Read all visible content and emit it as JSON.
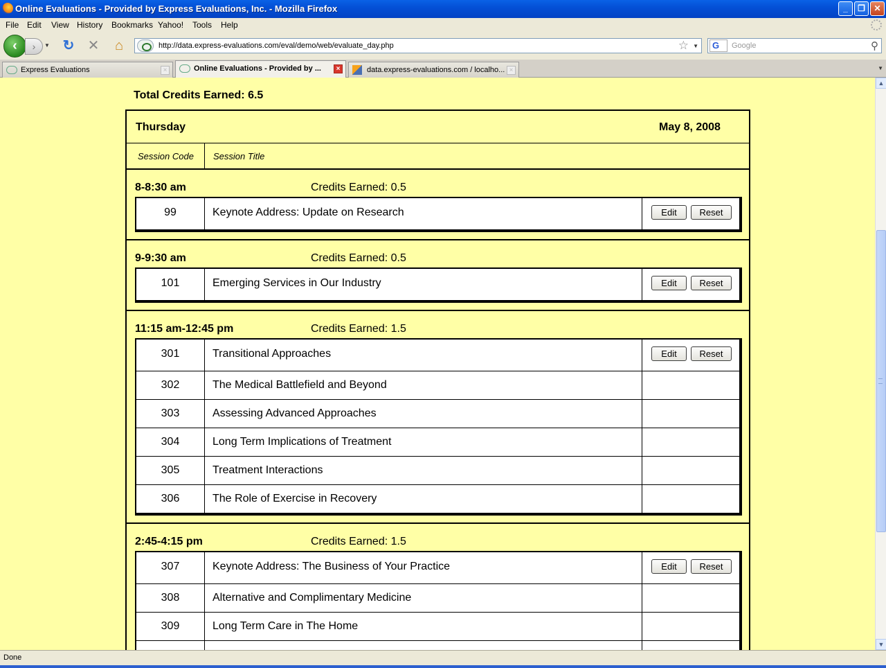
{
  "window": {
    "title": "Online Evaluations - Provided by Express Evaluations, Inc. - Mozilla Firefox",
    "minimize": "_",
    "restore": "❐",
    "close": "✕"
  },
  "menu": [
    "File",
    "Edit",
    "View",
    "History",
    "Bookmarks",
    "Yahoo!",
    "Tools",
    "Help"
  ],
  "nav": {
    "url": "http://data.express-evaluations.com/eval/demo/web/evaluate_day.php",
    "search_placeholder": "Google",
    "search_engine": "G"
  },
  "tabs": [
    {
      "label": "Express Evaluations",
      "active": false
    },
    {
      "label": "Online Evaluations - Provided by ...",
      "active": true
    },
    {
      "label": "data.express-evaluations.com / localho...",
      "active": false
    }
  ],
  "page": {
    "total_credits": "Total Credits Earned: 6.5",
    "day": "Thursday",
    "date": "May 8, 2008",
    "col_code": "Session Code",
    "col_title": "Session Title",
    "edit_label": "Edit",
    "reset_label": "Reset",
    "slots": [
      {
        "time": "8-8:30 am",
        "credits": "Credits Earned: 0.5",
        "sessions": [
          {
            "code": "99",
            "title": "Keynote Address: Update on Research",
            "actions": true
          }
        ]
      },
      {
        "time": "9-9:30 am",
        "credits": "Credits Earned: 0.5",
        "sessions": [
          {
            "code": "101",
            "title": "Emerging Services in Our Industry",
            "actions": true
          }
        ]
      },
      {
        "time": "11:15 am-12:45 pm",
        "credits": "Credits Earned: 1.5",
        "sessions": [
          {
            "code": "301",
            "title": "Transitional Approaches",
            "actions": true
          },
          {
            "code": "302",
            "title": "The Medical Battlefield and Beyond",
            "actions": false
          },
          {
            "code": "303",
            "title": "Assessing Advanced Approaches",
            "actions": false
          },
          {
            "code": "304",
            "title": "Long Term Implications of Treatment",
            "actions": false
          },
          {
            "code": "305",
            "title": "Treatment Interactions",
            "actions": false
          },
          {
            "code": "306",
            "title": "The Role of Exercise in Recovery",
            "actions": false
          }
        ]
      },
      {
        "time": "2:45-4:15 pm",
        "credits": "Credits Earned: 1.5",
        "sessions": [
          {
            "code": "307",
            "title": "Keynote Address: The Business of Your Practice",
            "actions": true
          },
          {
            "code": "308",
            "title": "Alternative and Complimentary Medicine",
            "actions": false
          },
          {
            "code": "309",
            "title": "Long Term Care in The Home",
            "actions": false
          },
          {
            "code": "",
            "title": "",
            "actions": false
          }
        ]
      }
    ]
  },
  "status": "Done",
  "colors": {
    "page_bg": "#ffffa6",
    "titlebar": "#0450d6"
  }
}
